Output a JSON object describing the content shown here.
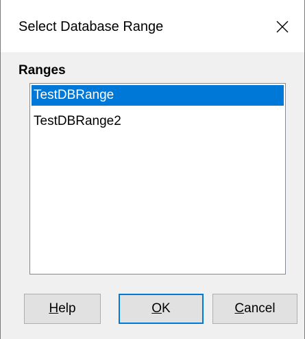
{
  "window": {
    "title": "Select Database Range",
    "close_icon": "close-icon"
  },
  "ranges": {
    "label": "Ranges",
    "items": [
      {
        "label": "TestDBRange",
        "selected": true
      },
      {
        "label": "TestDBRange2",
        "selected": false
      }
    ]
  },
  "buttons": {
    "help": {
      "mnemonic": "H",
      "rest": "elp"
    },
    "ok": {
      "mnemonic": "O",
      "rest": "K"
    },
    "cancel": {
      "mnemonic": "C",
      "rest": "ancel"
    }
  },
  "colors": {
    "selection": "#0078d7",
    "default_button_border": "#0078d7"
  }
}
